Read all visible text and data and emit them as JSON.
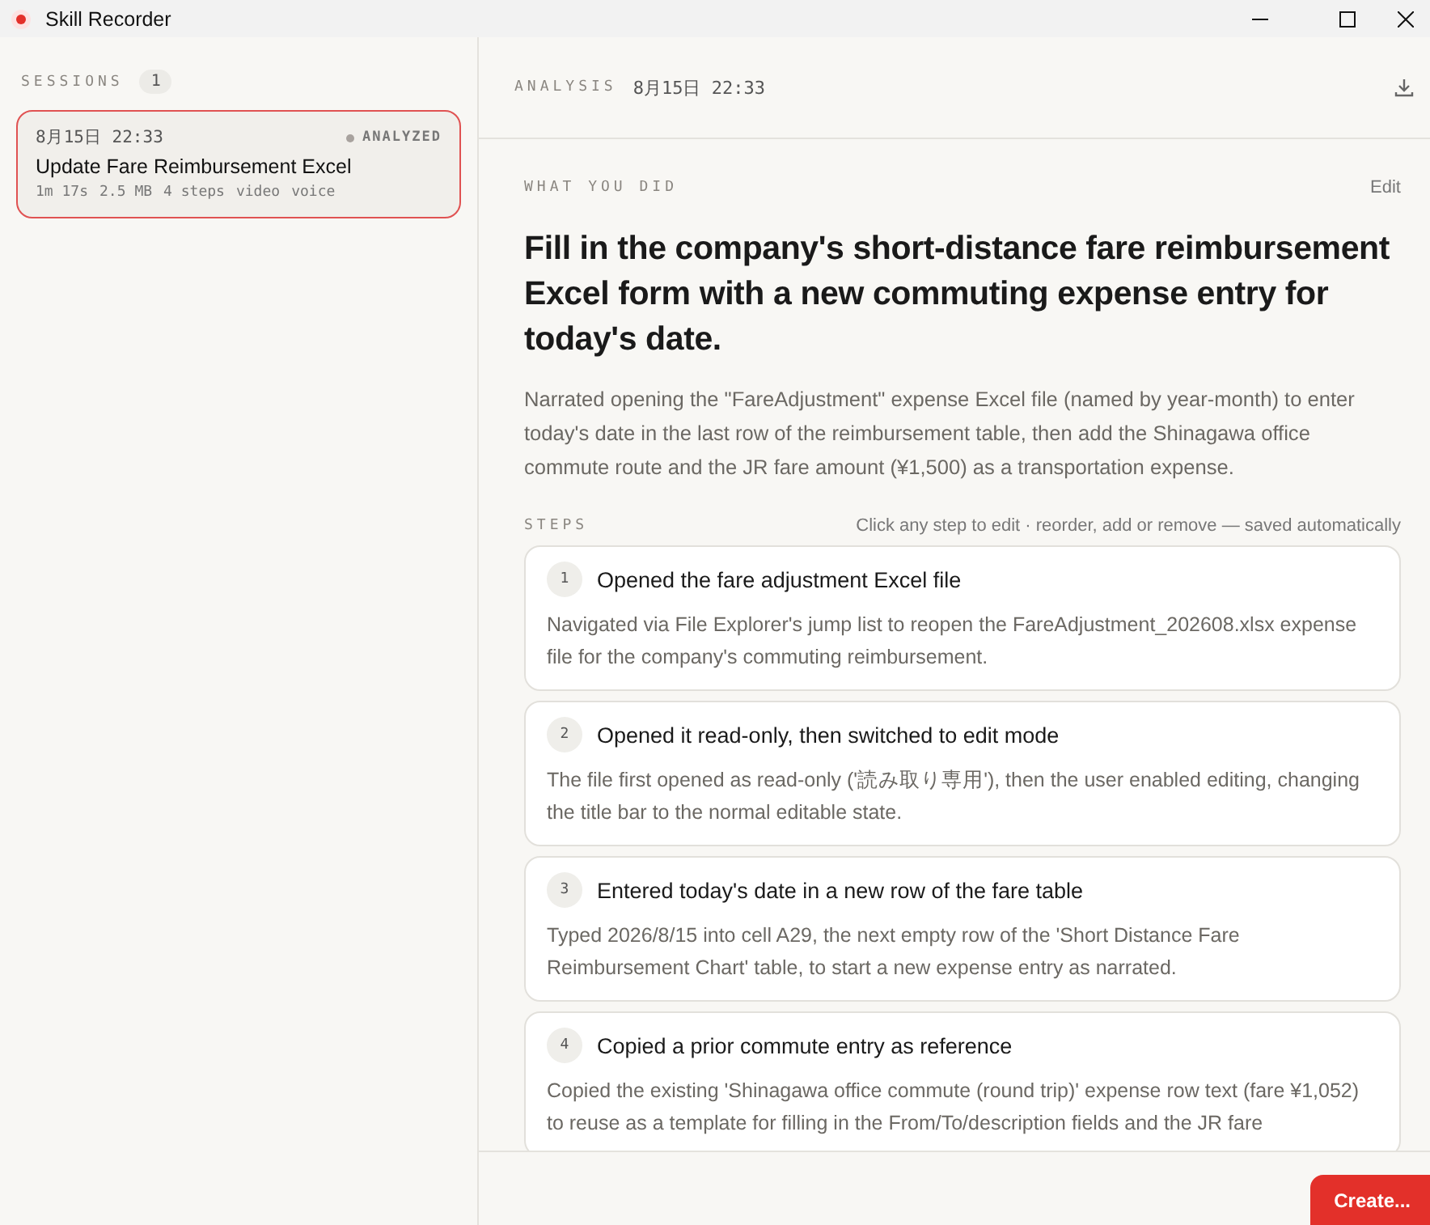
{
  "window": {
    "title": "Skill Recorder"
  },
  "sidebar": {
    "heading": "SESSIONS",
    "count": "1",
    "sessions": [
      {
        "date": "8月15日 22:33",
        "status": "ANALYZED",
        "color": "#a8a29e",
        "title": "Update Fare Reimbursement Excel",
        "meta": [
          "1m 17s",
          "2.5 MB",
          "4 steps",
          "video",
          "voice"
        ],
        "selected": true
      }
    ]
  },
  "header": {
    "label": "ANALYSIS",
    "date": "8月15日 22:33"
  },
  "summary": {
    "heading": "WHAT YOU DID",
    "edit": "Edit",
    "title": "Fill in the company's short-distance fare reimbursement Excel form with a new commuting expense entry for today's date.",
    "description": "Narrated opening the \"FareAdjustment\" expense Excel file (named by year-month) to enter today's date in the last row of the reimbursement table, then add the Shinagawa office commute route and the JR fare amount (¥1,500) as a transportation expense."
  },
  "steps": {
    "heading": "STEPS",
    "hint": "Click any step to edit · reorder, add or remove — saved automatically",
    "items": [
      {
        "number": "1",
        "title": "Opened the fare adjustment Excel file",
        "description": "Navigated via File Explorer's jump list to reopen the FareAdjustment_202608.xlsx expense file for the company's commuting reimbursement."
      },
      {
        "number": "2",
        "title": "Opened it read-only, then switched to edit mode",
        "description": "The file first opened as read-only ('読み取り専用'), then the user enabled editing, changing the title bar to the normal editable state."
      },
      {
        "number": "3",
        "title": "Entered today's date in a new row of the fare table",
        "description": "Typed 2026/8/15 into cell A29, the next empty row of the 'Short Distance Fare Reimbursement Chart' table, to start a new expense entry as narrated."
      },
      {
        "number": "4",
        "title": "Copied a prior commute entry as reference",
        "description": "Copied the existing 'Shinagawa office commute (round trip)' expense row text (fare ¥1,052) to reuse as a template for filling in the From/To/description fields and the JR fare"
      }
    ]
  },
  "footer": {
    "button": "Create..."
  }
}
